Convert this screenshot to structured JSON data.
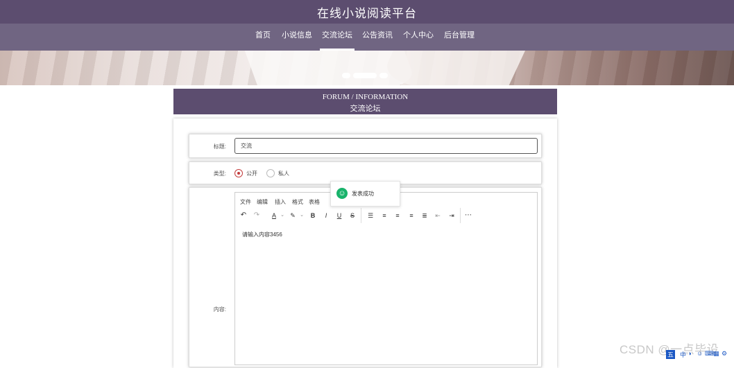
{
  "header": {
    "site_title": "在线小说阅读平台"
  },
  "nav": {
    "items": [
      {
        "label": "首页"
      },
      {
        "label": "小说信息"
      },
      {
        "label": "交流论坛"
      },
      {
        "label": "公告资讯"
      },
      {
        "label": "个人中心"
      },
      {
        "label": "后台管理"
      }
    ],
    "active": "交流论坛"
  },
  "section": {
    "title_en": "FORUM / INFORMATION",
    "title_zh": "交流论坛"
  },
  "form": {
    "title_label": "标题:",
    "title_value": "交流",
    "type_label": "类型:",
    "type_options": [
      "公开",
      "私人"
    ],
    "type_selected": "公开",
    "content_label": "内容:"
  },
  "editor": {
    "menu": [
      "文件",
      "编辑",
      "插入",
      "格式",
      "表格"
    ],
    "content": "请输入内容3456",
    "toolbar_icons": [
      "undo-icon",
      "redo-icon",
      "text-color-icon",
      "highlight-icon",
      "bold-icon",
      "italic-icon",
      "underline-icon",
      "strikethrough-icon",
      "list-icon",
      "align-left-icon",
      "align-center-icon",
      "align-right-icon",
      "justify-icon",
      "outdent-icon",
      "indent-icon",
      "more-icon"
    ]
  },
  "toast": {
    "message": "发表成功"
  },
  "watermark": {
    "text": "CSDN @一点毕设"
  },
  "colors": {
    "primary": "#5c4d6f",
    "nav": "#706582",
    "success": "#19b36b",
    "radio_checked": "#c23b3b"
  }
}
